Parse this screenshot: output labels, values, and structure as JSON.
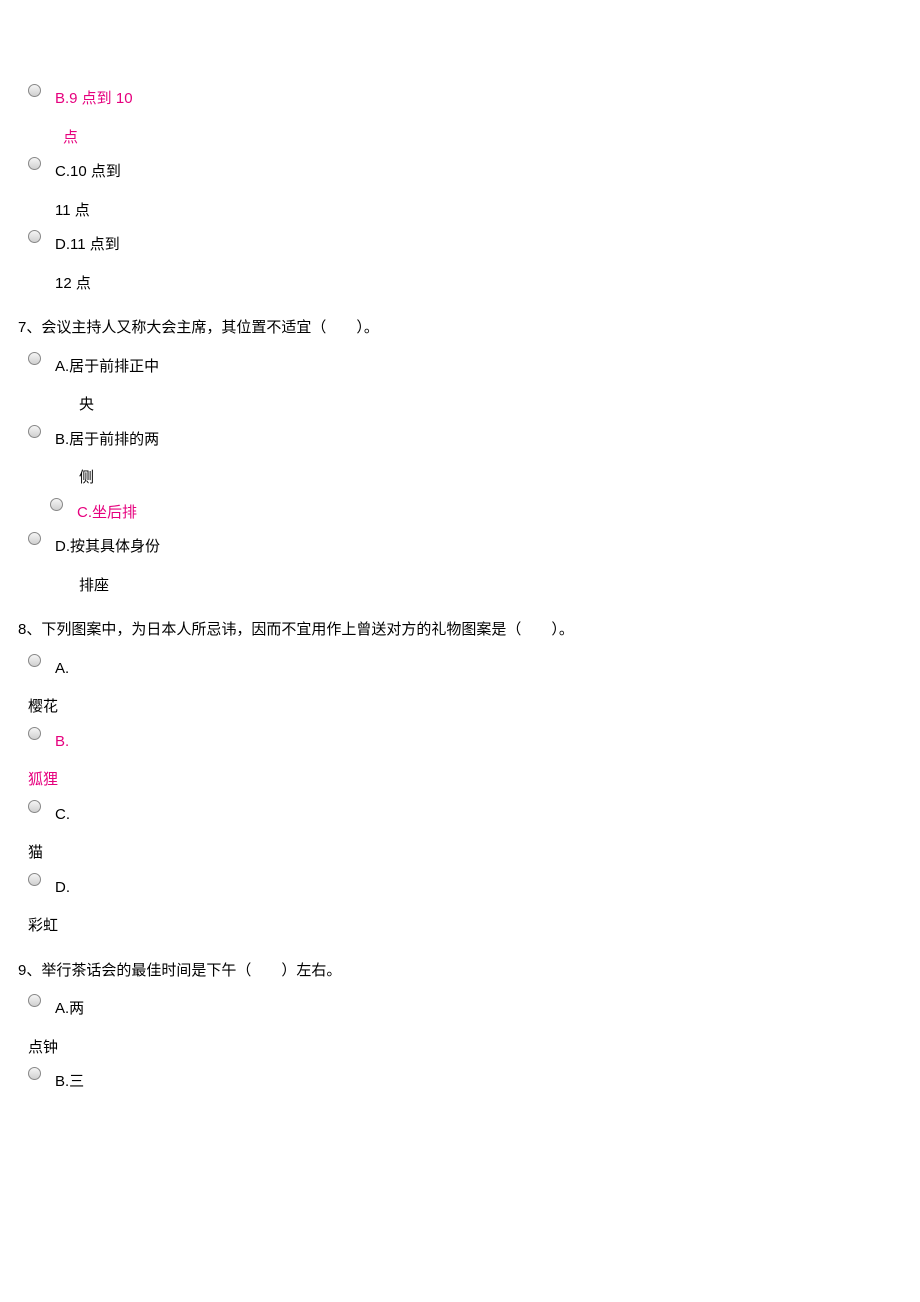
{
  "q6_options": {
    "b": {
      "line1": "B.9 点到 10",
      "line2": "点"
    },
    "c": {
      "line1": "C.10 点到",
      "line2": "11 点"
    },
    "d": {
      "line1": "D.11 点到",
      "line2": "12 点"
    }
  },
  "q7": {
    "text": "7、会议主持人又称大会主席，其位置不适宜（　　）。",
    "a": {
      "line1": "A.居于前排正中",
      "line2": "央"
    },
    "b": {
      "line1": "B.居于前排的两",
      "line2": "侧"
    },
    "c": {
      "line1": "C.坐后排"
    },
    "d": {
      "line1": "D.按其具体身份",
      "line2": "排座"
    }
  },
  "q8": {
    "text": "8、下列图案中，为日本人所忌讳，因而不宜用作上曾送对方的礼物图案是（　　）。",
    "a": {
      "line1": "A.",
      "line2": "樱花"
    },
    "b": {
      "line1": "B.",
      "line2": "狐狸"
    },
    "c": {
      "line1": "C.",
      "line2": "猫"
    },
    "d": {
      "line1": "D.",
      "line2": "彩虹"
    }
  },
  "q9": {
    "text": "9、举行茶话会的最佳时间是下午（　　）左右。",
    "a": {
      "line1": "A.两",
      "line2": "点钟"
    },
    "b": {
      "line1": "B.三"
    }
  }
}
